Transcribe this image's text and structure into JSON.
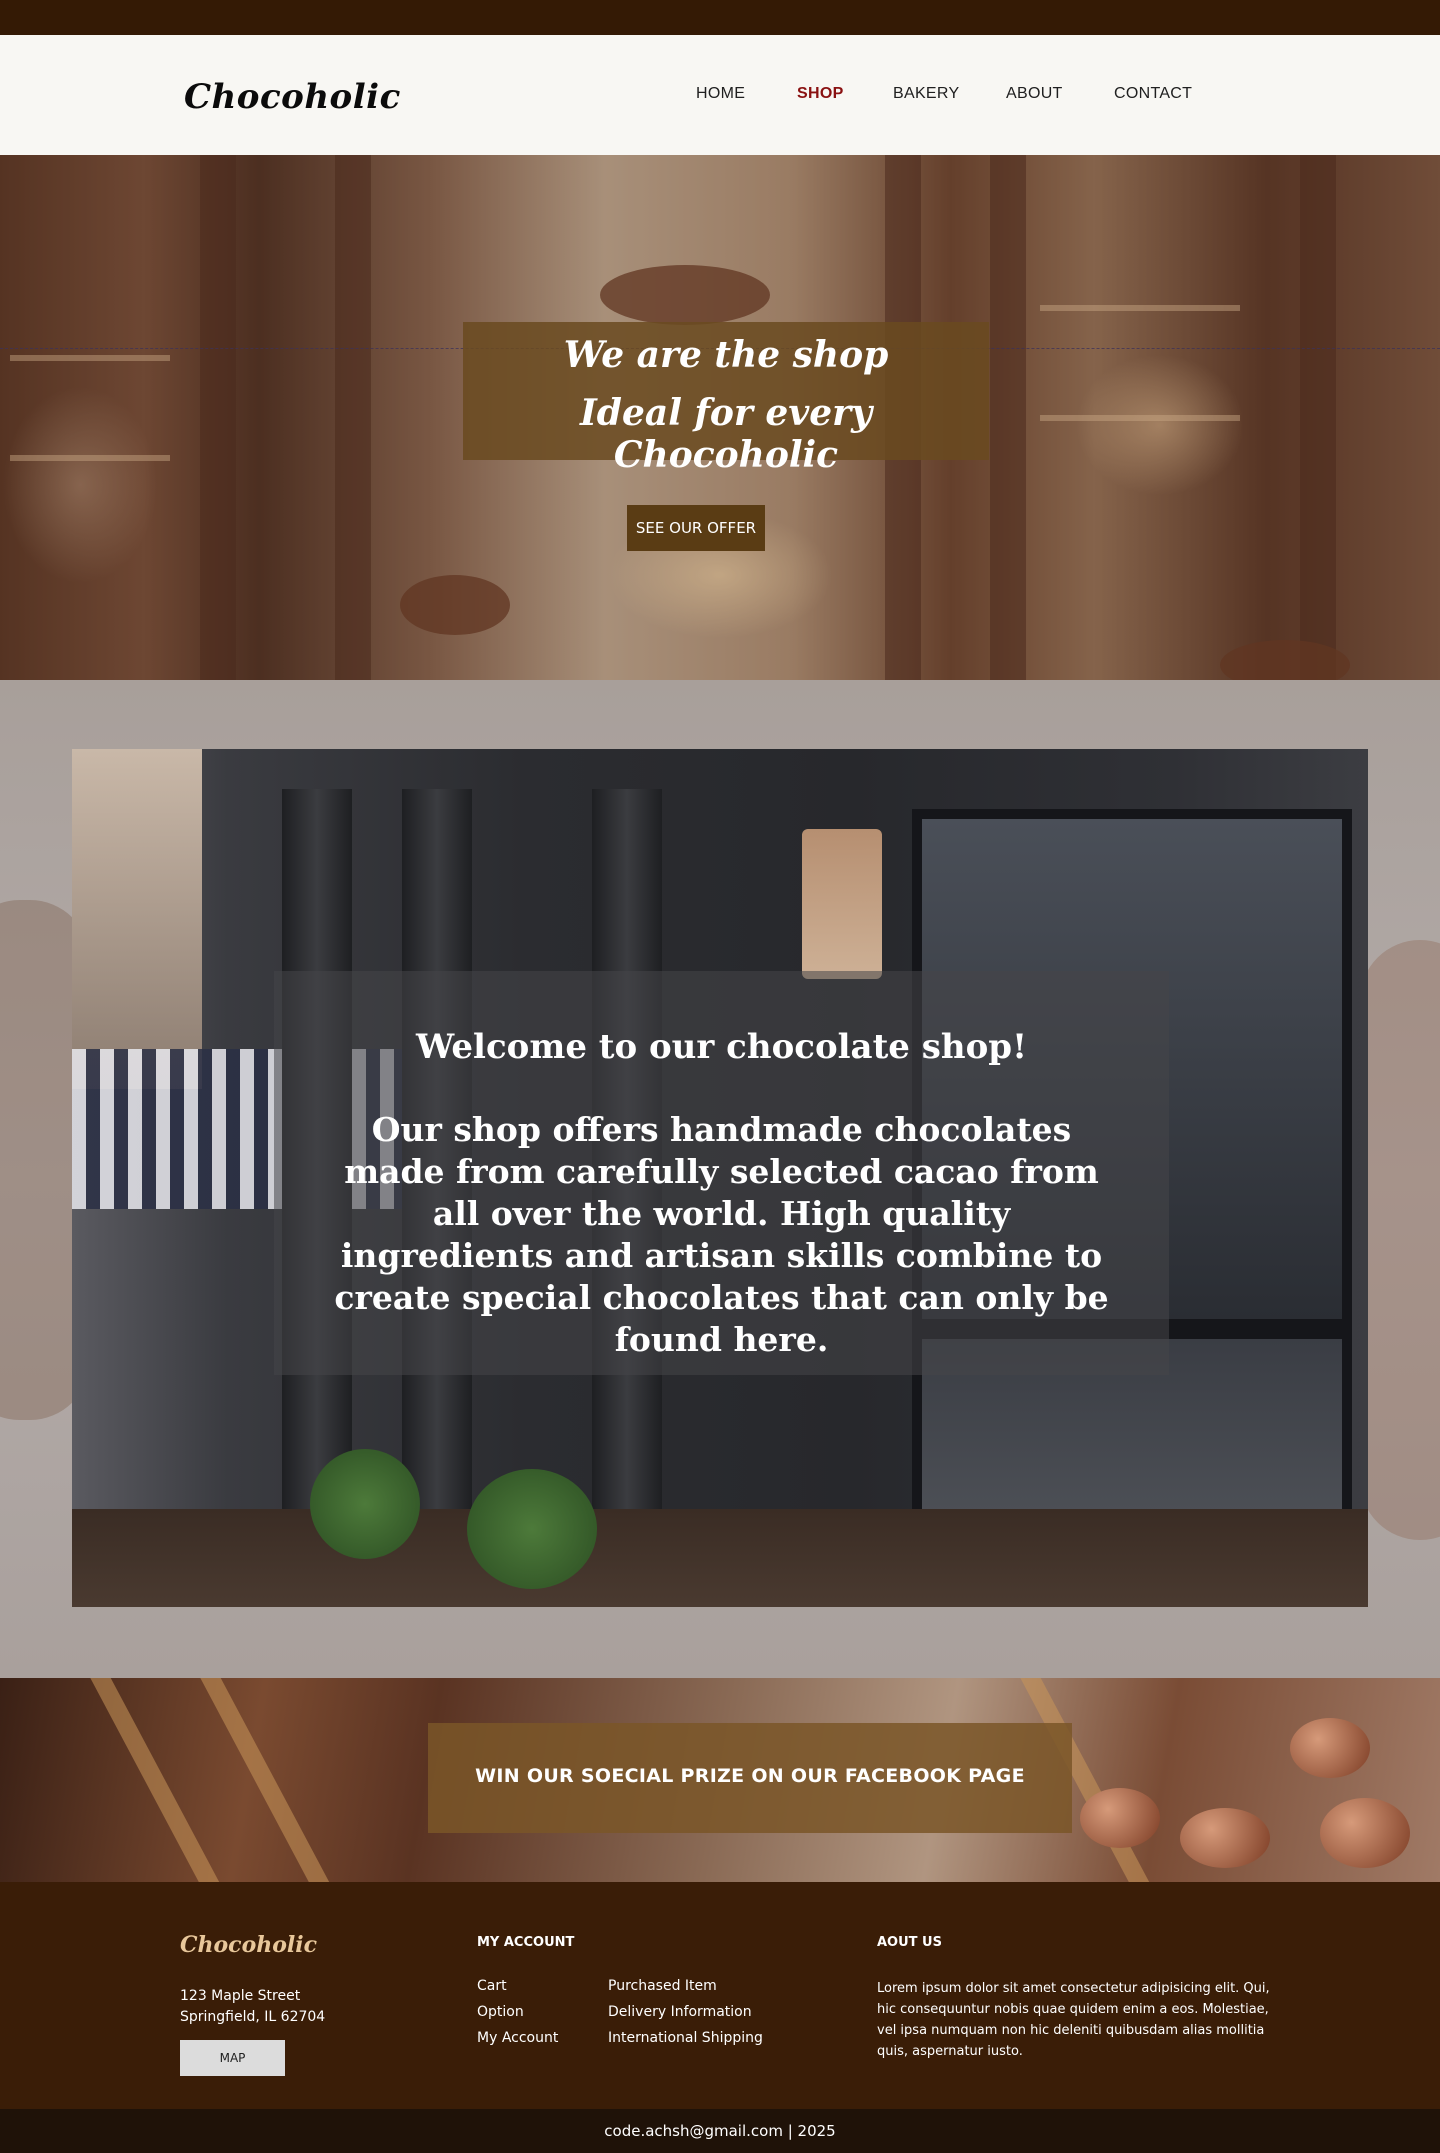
{
  "header": {
    "logo": "Chocoholic",
    "nav": [
      {
        "label": "HOME",
        "active": false
      },
      {
        "label": "SHOP",
        "active": true
      },
      {
        "label": "BAKERY",
        "active": false
      },
      {
        "label": "ABOUT",
        "active": false
      },
      {
        "label": "CONTACT",
        "active": false
      }
    ]
  },
  "hero": {
    "line1": "We are the shop",
    "line2": "Ideal for every Chocoholic",
    "button": "SEE OUR OFFER"
  },
  "welcome": {
    "title": "Welcome to our chocolate shop!",
    "text": "Our shop offers handmade chocolates made from carefully selected cacao from all over the world. High quality ingredients and artisan skills combine to create special chocolates that can only be found here."
  },
  "promo": {
    "text": "WIN OUR SOECIAL PRIZE ON OUR FACEBOOK PAGE"
  },
  "footer": {
    "logo": "Chocoholic",
    "address_line1": "123 Maple Street",
    "address_line2": "Springfield, IL 62704",
    "map_button": "MAP",
    "account_heading": "MY ACCOUNT",
    "account_links_col1": [
      "Cart",
      "Option",
      "My Account"
    ],
    "account_links_col2": [
      "Purchased Item",
      "Delivery Information",
      "International Shipping"
    ],
    "about_heading": "AOUT US",
    "about_text": "Lorem ipsum dolor sit amet consectetur adipisicing elit. Qui, hic consequuntur nobis quae quidem enim a eos. Molestiae, vel ipsa numquam non hic deleniti quibusdam alias mollitia quis, aspernatur iusto."
  },
  "bottom": {
    "text": "code.achsh@gmail.com | 2025"
  },
  "colors": {
    "topbar": "#341a05",
    "header_bg": "#f8f7f3",
    "nav_active": "#8a1111",
    "hero_box": "#6a4a20",
    "hero_button": "#5a3c14",
    "promo_box": "#7a5628",
    "footer_bg": "#3a1d07",
    "footer_logo": "#e8c79a",
    "bottom_bg": "#1f1208"
  }
}
